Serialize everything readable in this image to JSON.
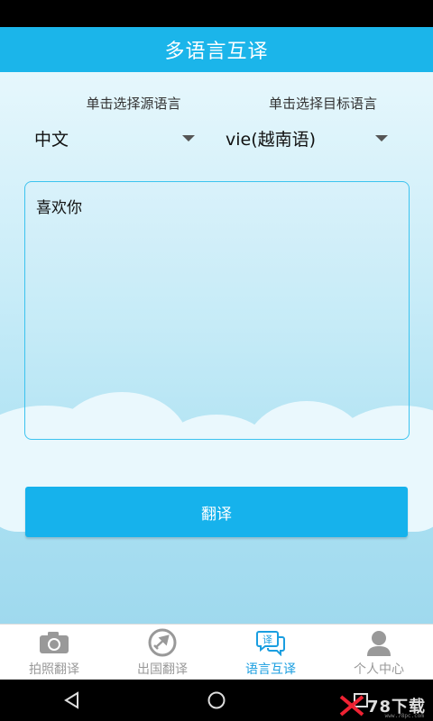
{
  "header": {
    "title": "多语言互译"
  },
  "source_lang": {
    "hint": "单击选择源语言",
    "value": "中文"
  },
  "target_lang": {
    "hint": "单击选择目标语言",
    "value": "vie(越南语)"
  },
  "input": {
    "value": "喜欢你"
  },
  "translate_button": {
    "label": "翻译"
  },
  "tabs": [
    {
      "label": "拍照翻译",
      "icon": "camera-icon",
      "active": false
    },
    {
      "label": "出国翻译",
      "icon": "airplane-icon",
      "active": false
    },
    {
      "label": "语言互译",
      "icon": "translate-chat-icon",
      "active": true
    },
    {
      "label": "个人中心",
      "icon": "person-icon",
      "active": false
    }
  ],
  "translate_icon_glyph": "译",
  "watermark": {
    "text": "78下载",
    "url": "www.78pc.com"
  },
  "colors": {
    "header": "#1bb5ea",
    "button": "#16b2ec",
    "active_tab": "#1a9ee0",
    "inactive_tab": "#999999",
    "border": "#3cc3ef"
  }
}
